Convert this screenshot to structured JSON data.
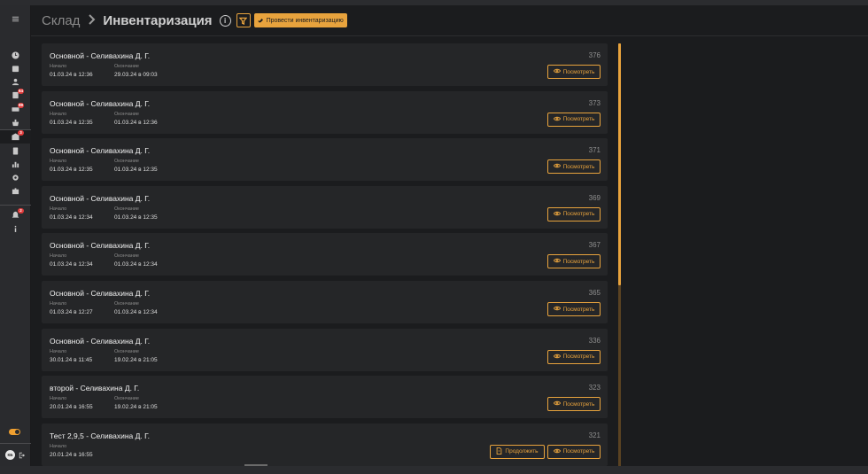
{
  "header": {
    "breadcrumb_root": "Склад",
    "breadcrumb_current": "Инвентаризация",
    "primary_action": "Провести инвентаризацию"
  },
  "labels": {
    "start": "Начало",
    "end": "Окончание",
    "view": "Посмотреть",
    "continue": "Продолжить"
  },
  "sidebar": {
    "badges": [
      "64",
      "99",
      "3",
      "2"
    ],
    "user_initials": "КБ"
  },
  "inventories": [
    {
      "title": "Основной - Селивахина Д. Г.",
      "number": "376",
      "start": "01.03.24 в 12:36",
      "end": "29.03.24 в 09:03"
    },
    {
      "title": "Основной - Селивахина Д. Г.",
      "number": "373",
      "start": "01.03.24 в 12:35",
      "end": "01.03.24 в 12:36"
    },
    {
      "title": "Основной - Селивахина Д. Г.",
      "number": "371",
      "start": "01.03.24 в 12:35",
      "end": "01.03.24 в 12:35"
    },
    {
      "title": "Основной - Селивахина Д. Г.",
      "number": "369",
      "start": "01.03.24 в 12:34",
      "end": "01.03.24 в 12:35"
    },
    {
      "title": "Основной - Селивахина Д. Г.",
      "number": "367",
      "start": "01.03.24 в 12:34",
      "end": "01.03.24 в 12:34"
    },
    {
      "title": "Основной - Селивахина Д. Г.",
      "number": "365",
      "start": "01.03.24 в 12:27",
      "end": "01.03.24 в 12:34"
    },
    {
      "title": "Основной - Селивахина Д. Г.",
      "number": "336",
      "start": "30.01.24 в 11:45",
      "end": "19.02.24 в 21:05"
    },
    {
      "title": "второй - Селивахина Д. Г.",
      "number": "323",
      "start": "20.01.24 в 16:55",
      "end": "19.02.24 в 21:05"
    },
    {
      "title": "Тест 2,9,5 - Селивахина Д. Г.",
      "number": "321",
      "start": "20.01.24 в 16:55",
      "end": ""
    }
  ],
  "colors": {
    "accent": "#e8a33d",
    "background": "#1b1c1e",
    "card": "#252628",
    "badge": "#e23b3b"
  }
}
